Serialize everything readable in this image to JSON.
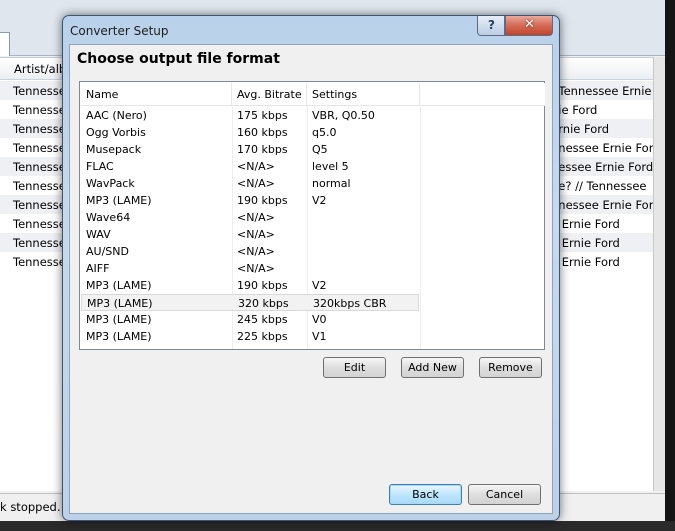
{
  "background": {
    "column_header": "Artist/alb",
    "row_left_text": "Tennesse",
    "rows_right": [
      "/ Tennessee Ernie",
      "nie Ford",
      "Ernie Ford",
      "nnessee Ernie Ford",
      "nessee Ernie Ford",
      "ge? // Tennessee",
      "nnessee Ernie For",
      "e Ernie Ford",
      "e Ernie Ford",
      "e Ernie Ford"
    ],
    "status_text": "k stopped."
  },
  "dialog": {
    "title": "Converter Setup",
    "help_glyph": "?",
    "close_glyph": "✕",
    "heading": "Choose output file format",
    "columns": {
      "name": "Name",
      "bitrate": "Avg. Bitrate",
      "settings": "Settings"
    },
    "formats": [
      {
        "name": "AAC (Nero)",
        "bitrate": "175 kbps",
        "settings": "VBR, Q0.50"
      },
      {
        "name": "Ogg Vorbis",
        "bitrate": "160 kbps",
        "settings": "q5.0"
      },
      {
        "name": "Musepack",
        "bitrate": "170 kbps",
        "settings": "Q5"
      },
      {
        "name": "FLAC",
        "bitrate": "<N/A>",
        "settings": "level 5"
      },
      {
        "name": "WavPack",
        "bitrate": "<N/A>",
        "settings": "normal"
      },
      {
        "name": "MP3 (LAME)",
        "bitrate": "190 kbps",
        "settings": "V2"
      },
      {
        "name": "Wave64",
        "bitrate": "<N/A>",
        "settings": ""
      },
      {
        "name": "WAV",
        "bitrate": "<N/A>",
        "settings": ""
      },
      {
        "name": "AU/SND",
        "bitrate": "<N/A>",
        "settings": ""
      },
      {
        "name": "AIFF",
        "bitrate": "<N/A>",
        "settings": ""
      },
      {
        "name": "MP3 (LAME)",
        "bitrate": "190 kbps",
        "settings": "V2"
      },
      {
        "name": "MP3 (LAME)",
        "bitrate": "320 kbps",
        "settings": "320kbps CBR",
        "selected": true
      },
      {
        "name": "MP3 (LAME)",
        "bitrate": "245 kbps",
        "settings": "V0"
      },
      {
        "name": "MP3 (LAME)",
        "bitrate": "225 kbps",
        "settings": "V1"
      }
    ],
    "buttons": {
      "edit": "Edit",
      "add_new": "Add New",
      "remove": "Remove",
      "back": "Back",
      "cancel": "Cancel"
    }
  }
}
